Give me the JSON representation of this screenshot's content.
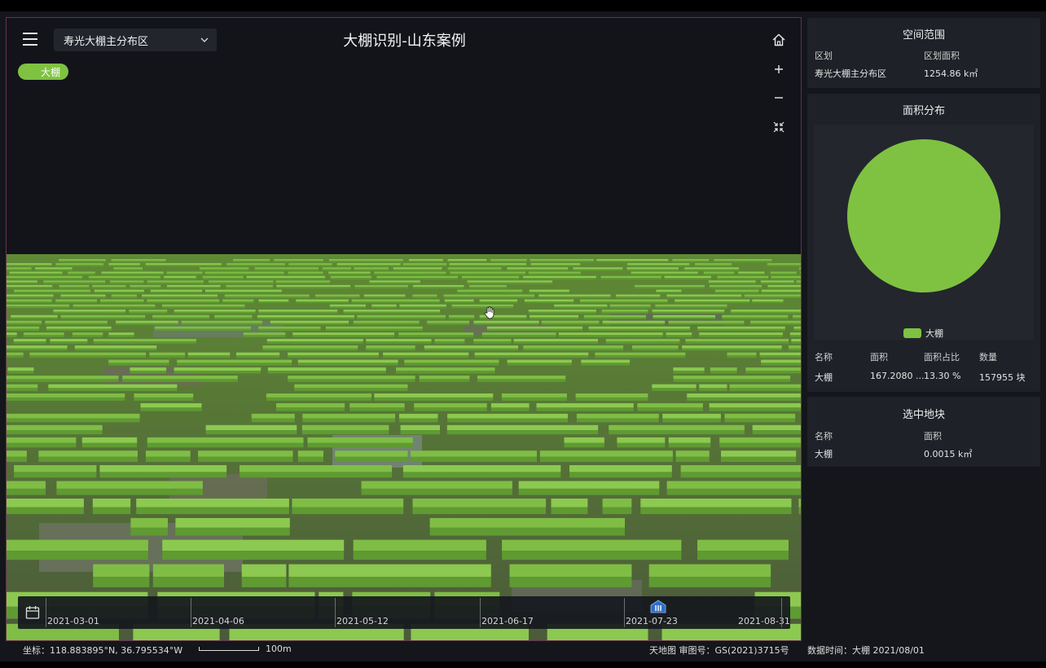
{
  "header": {
    "region": "寿光大棚主分布区",
    "title": "大棚识别-山东案例"
  },
  "legend": {
    "label": "大棚",
    "color": "#7fc241"
  },
  "timeline": {
    "dates": [
      "2021-03-01",
      "2021-04-06",
      "2021-05-12",
      "2021-06-17",
      "2021-07-23",
      "2021-08-31"
    ],
    "selected": "2021-07-23"
  },
  "status": {
    "coords": "坐标：118.883895°N, 36.795534°W",
    "scale": "100m",
    "attribution": "天地图 审图号：GS(2021)3715号",
    "data_time": "数据时间：大棚 2021/08/01"
  },
  "panels": {
    "extent": {
      "title": "空间范围",
      "col1": "区划",
      "col2": "区划面积",
      "name": "寿光大棚主分布区",
      "area": "1254.86 k㎡"
    },
    "distribution": {
      "title": "面积分布",
      "legend": "大棚",
      "headers": [
        "名称",
        "面积",
        "面积占比",
        "数量"
      ],
      "row": [
        "大棚",
        "167.2080 ...",
        "13.30 %",
        "157955 块"
      ]
    },
    "selected": {
      "title": "选中地块",
      "col1": "名称",
      "col2": "面积",
      "name": "大棚",
      "area": "0.0015 k㎡"
    }
  },
  "chart_data": {
    "type": "pie",
    "categories": [
      "大棚"
    ],
    "values": [
      100
    ],
    "colors": [
      "#7fc241"
    ]
  }
}
